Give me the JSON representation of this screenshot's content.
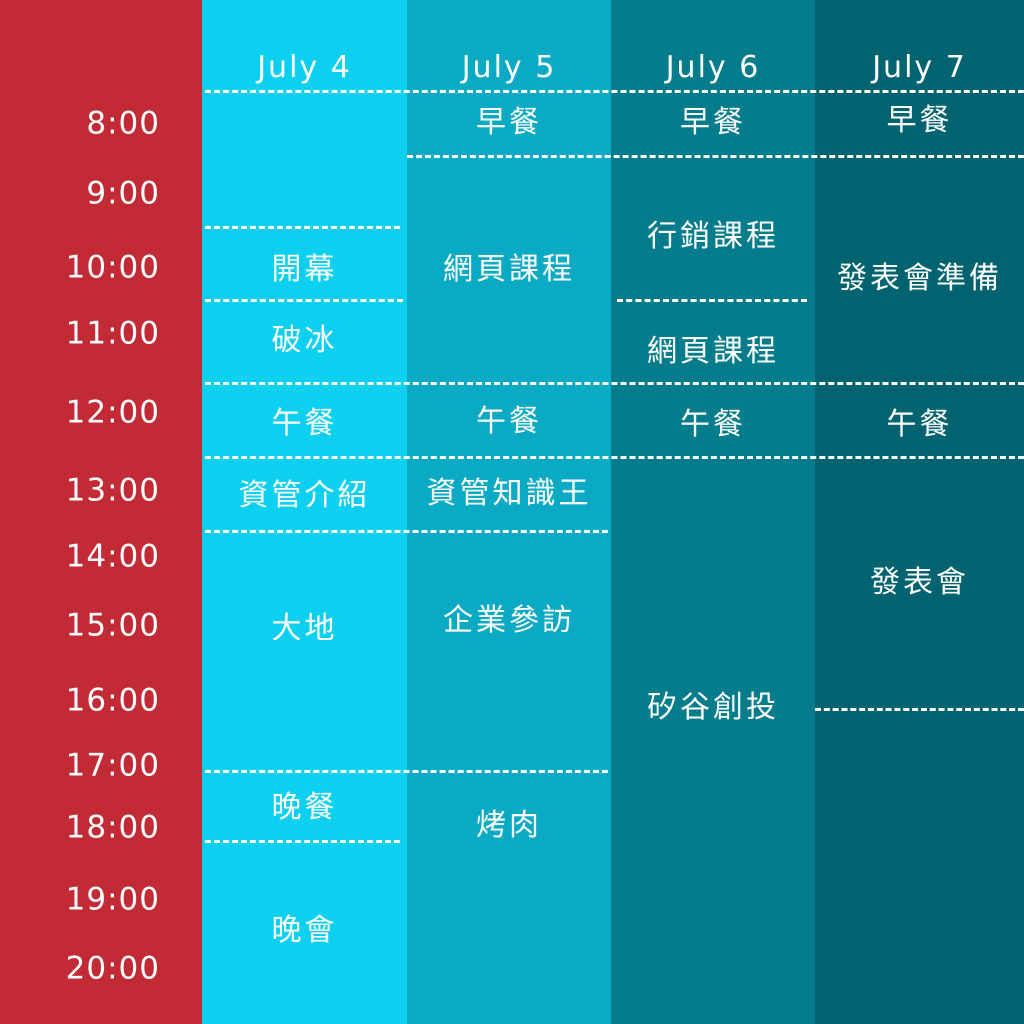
{
  "colors": {
    "time_column": "#C22A35",
    "july4": "#0DCFF0",
    "july5": "#0BAAC4",
    "july6": "#057C8B",
    "july7": "#026370",
    "text": "#FFFFFF"
  },
  "times": [
    "8:00",
    "9:00",
    "10:00",
    "11:00",
    "12:00",
    "13:00",
    "14:00",
    "15:00",
    "16:00",
    "17:00",
    "18:00",
    "19:00",
    "20:00"
  ],
  "days": [
    {
      "date": "July 4",
      "events": [
        {
          "label": "開幕"
        },
        {
          "label": "破冰"
        },
        {
          "label": "午餐"
        },
        {
          "label": "資管介紹"
        },
        {
          "label": "大地"
        },
        {
          "label": "晚餐"
        },
        {
          "label": "晚會"
        }
      ]
    },
    {
      "date": "July 5",
      "events": [
        {
          "label": "早餐"
        },
        {
          "label": "網頁課程"
        },
        {
          "label": "午餐"
        },
        {
          "label": "資管知識王"
        },
        {
          "label": "企業參訪"
        },
        {
          "label": "烤肉"
        }
      ]
    },
    {
      "date": "July 6",
      "events": [
        {
          "label": "早餐"
        },
        {
          "label": "行銷課程"
        },
        {
          "label": "網頁課程"
        },
        {
          "label": "午餐"
        },
        {
          "label": "矽谷創投"
        }
      ]
    },
    {
      "date": "July 7",
      "events": [
        {
          "label": "早餐"
        },
        {
          "label": "發表會準備"
        },
        {
          "label": "午餐"
        },
        {
          "label": "發表會"
        }
      ]
    }
  ]
}
